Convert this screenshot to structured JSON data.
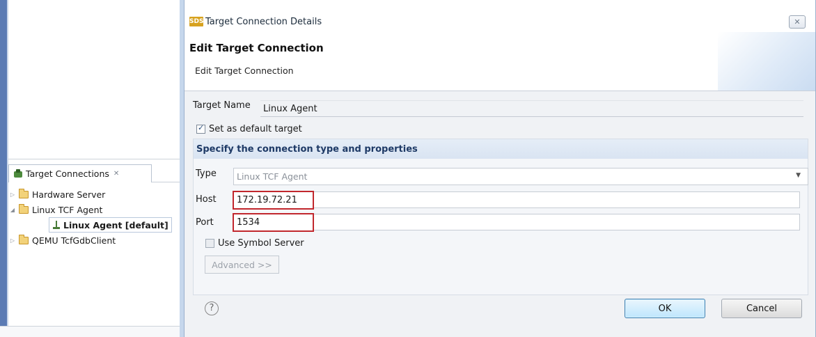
{
  "target_connections": {
    "tab_title": "Target Connections",
    "tab_close_glyph": "✕",
    "tree": [
      {
        "label": "Hardware Server",
        "expanded": false,
        "icon": "folder-icon"
      },
      {
        "label": "Linux TCF Agent",
        "expanded": true,
        "icon": "folder-icon"
      },
      {
        "label": "Linux Agent [default]",
        "icon": "agent-icon",
        "selected": true
      },
      {
        "label": "QEMU TcfGdbClient",
        "expanded": false,
        "icon": "folder-icon"
      }
    ]
  },
  "dialog": {
    "app_icon_text": "SDS",
    "title": "Target Connection Details",
    "close_glyph": "✕",
    "banner_title": "Edit Target Connection",
    "banner_description": "Edit Target Connection",
    "target_name_label": "Target Name",
    "target_name_value": "Linux Agent",
    "default_target_label": "Set as default target",
    "default_target_checked": true,
    "section_header": "Specify the connection type and properties",
    "type_label": "Type",
    "type_value": "Linux TCF Agent",
    "host_label": "Host",
    "host_value": "172.19.72.21",
    "port_label": "Port",
    "port_value": "1534",
    "symbol_server_label": "Use Symbol Server",
    "symbol_server_checked": false,
    "advanced_label": "Advanced >>",
    "help_glyph": "?",
    "ok_label": "OK",
    "cancel_label": "Cancel"
  },
  "colors": {
    "highlight_border": "#c1272d",
    "section_header_text": "#1e3a66",
    "ok_button_border": "#3c7fb1"
  }
}
